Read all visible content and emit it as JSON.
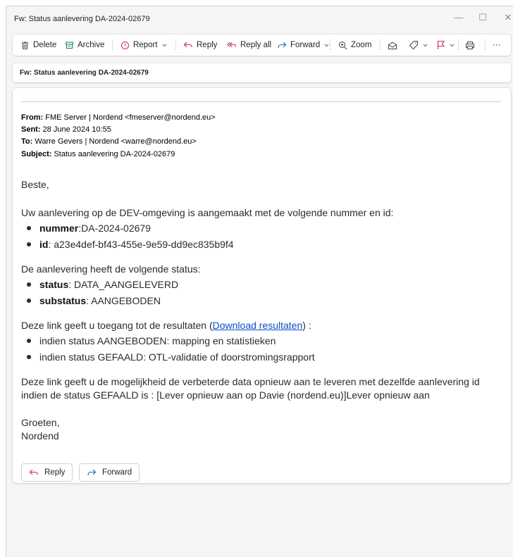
{
  "window": {
    "title": "Fw: Status aanlevering DA-2024-02679",
    "controls": {
      "minimize": "—",
      "maximize": "☐",
      "close": "✕"
    }
  },
  "toolbar": {
    "delete": "Delete",
    "archive": "Archive",
    "report": "Report",
    "reply": "Reply",
    "reply_all": "Reply all",
    "forward": "Forward",
    "zoom": "Zoom",
    "more": "···"
  },
  "subject_bar": "Fw: Status aanlevering DA-2024-02679",
  "forward_header": {
    "from_label": "From:",
    "from_value": "FME Server | Nordend <fmeserver@nordend.eu>",
    "sent_label": "Sent:",
    "sent_value": "28 June 2024 10:55",
    "to_label": "To:",
    "to_value": "Warre Gevers | Nordend <warre@nordend.eu>",
    "subject_label": "Subject:",
    "subject_value": "Status aanlevering DA-2024-02679"
  },
  "body": {
    "greeting": "Beste,",
    "intro": "Uw aanlevering op de DEV-omgeving is aangemaakt met de volgende nummer en id:",
    "ids": [
      {
        "key": "nummer",
        "value": ":DA-2024-02679"
      },
      {
        "key": "id",
        "value": ": a23e4def-bf43-455e-9e59-dd9ec835b9f4"
      }
    ],
    "status_intro": "De aanlevering heeft de volgende status:",
    "statuses": [
      {
        "key": "status",
        "value": ": DATA_AANGELEVERD"
      },
      {
        "key": "substatus",
        "value": ": AANGEBODEN"
      }
    ],
    "link_pre": "Deze link geeft u toegang tot de resultaten (",
    "link_text": "Download resultaten",
    "link_post": ") :",
    "link_items": [
      "indien status AANGEBODEN: mapping en statistieken",
      "indien status GEFAALD: OTL-validatie of doorstromingsrapport"
    ],
    "redeliver_line1": "Deze link geeft u de mogelijkheid de verbeterde data opnieuw aan te leveren met dezelfde aanlevering id",
    "redeliver_line2": "indien de status GEFAALD is : [Lever opnieuw aan op Davie (nordend.eu)]Lever opnieuw aan",
    "closing": "Groeten,",
    "signature": "Nordend"
  },
  "actions": {
    "reply": "Reply",
    "forward": "Forward"
  },
  "colors": {
    "accent_red": "#c4314b",
    "accent_green": "#107c41",
    "accent_blue": "#0f6cbd",
    "link": "#0f4cc9"
  }
}
